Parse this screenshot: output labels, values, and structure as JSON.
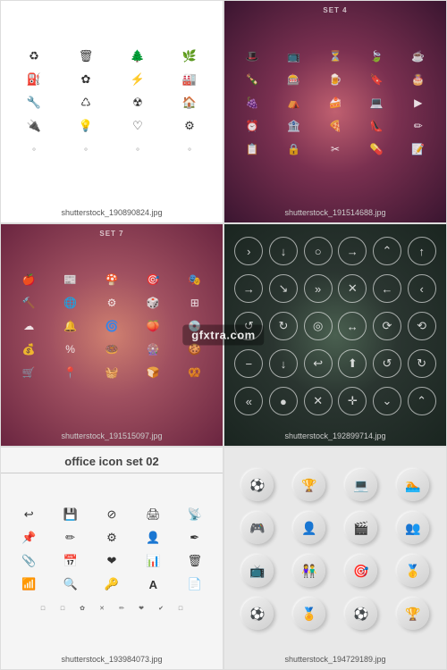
{
  "watermark": "gfxtra.com",
  "cells": [
    {
      "id": "cell-1",
      "label": "shutterstock_190890824.jpg",
      "set_label": null,
      "bg": "white",
      "icons_light": false,
      "rows": [
        [
          "♻",
          "🗑",
          "🌳",
          "🌿"
        ],
        [
          "⛽",
          "🌸",
          "⚡",
          "🏭"
        ],
        [
          "🔧",
          "♺",
          "☢",
          "🏠"
        ],
        [
          "🔌",
          "💡",
          "❤",
          "⚙"
        ],
        [
          "➰",
          "—",
          "—",
          "—"
        ]
      ]
    },
    {
      "id": "cell-2",
      "label": "shutterstock_191514688.jpg",
      "set_label": "SET 4",
      "bg": "dark-pink",
      "icons_light": true,
      "rows": [
        [
          "🎩",
          "📺",
          "⏳",
          "🍃"
        ],
        [
          "🧃",
          "🎰",
          "🍺",
          "🔖"
        ],
        [
          "🍇",
          "⛺",
          "🍰",
          "💻"
        ],
        [
          "⏰",
          "🏦",
          "🍕",
          "👠"
        ],
        [
          "📋",
          "🔒",
          "✂",
          "💊"
        ]
      ]
    },
    {
      "id": "cell-3",
      "label": "shutterstock_191515097.jpg",
      "set_label": "SET 7",
      "bg": "pink",
      "icons_light": true,
      "rows": [
        [
          "🍎",
          "📰",
          "🍄",
          "🎯",
          "🎭"
        ],
        [
          "🔨",
          "🌐",
          "⚙",
          "🎲",
          "—"
        ],
        [
          "☁",
          "🔔",
          "🌀",
          "🍑",
          "🥏"
        ],
        [
          "💰",
          "🔔",
          "🎯",
          "🍩",
          "🎡"
        ],
        [
          "🛒",
          "📍",
          "🧺",
          "🍞",
          "—"
        ]
      ]
    },
    {
      "id": "cell-4",
      "label": "shutterstock_192899714.jpg",
      "set_label": null,
      "bg": "dark-green",
      "icons_light": true,
      "arrows": [
        [
          ">",
          "↓",
          "○",
          ">",
          "⌃"
        ],
        [
          "→",
          "→",
          ">",
          "✕",
          "←"
        ],
        [
          "↺",
          "↻",
          "◎",
          "↔",
          "↺"
        ],
        [
          "—",
          "↓",
          "←",
          "⬆",
          "—"
        ],
        [
          "≪",
          "◉",
          "✕",
          "✕",
          "⌄"
        ]
      ]
    },
    {
      "id": "cell-5",
      "label": "shutterstock_193984073.jpg",
      "title": "office icon set 02",
      "bg": "light-gray",
      "icons_light": false,
      "rows": [
        [
          "↩",
          "💾",
          "⊘",
          "🖨",
          "📡"
        ],
        [
          "📌",
          "✏",
          "⚙",
          "👤",
          "✏"
        ],
        [
          "📎",
          "📅",
          "❤",
          "📊",
          "🗑"
        ],
        [
          "📶",
          "🔍",
          "🔑",
          "A",
          "📄"
        ],
        [
          "□",
          "□",
          "□",
          "□",
          "□",
          "□",
          "□",
          "□",
          "□",
          "□"
        ]
      ]
    },
    {
      "id": "cell-6",
      "label": "shutterstock_194729189.jpg",
      "bg": "light",
      "icons_light": false,
      "circles": [
        [
          "⚽",
          "🏆",
          "💻",
          "🏊"
        ],
        [
          "🎮",
          "👤",
          "🎬",
          "—"
        ],
        [
          "📺",
          "👥",
          "🎯",
          "—"
        ],
        [
          "⚽",
          "🏅",
          "⚽",
          "🏆"
        ]
      ]
    }
  ]
}
